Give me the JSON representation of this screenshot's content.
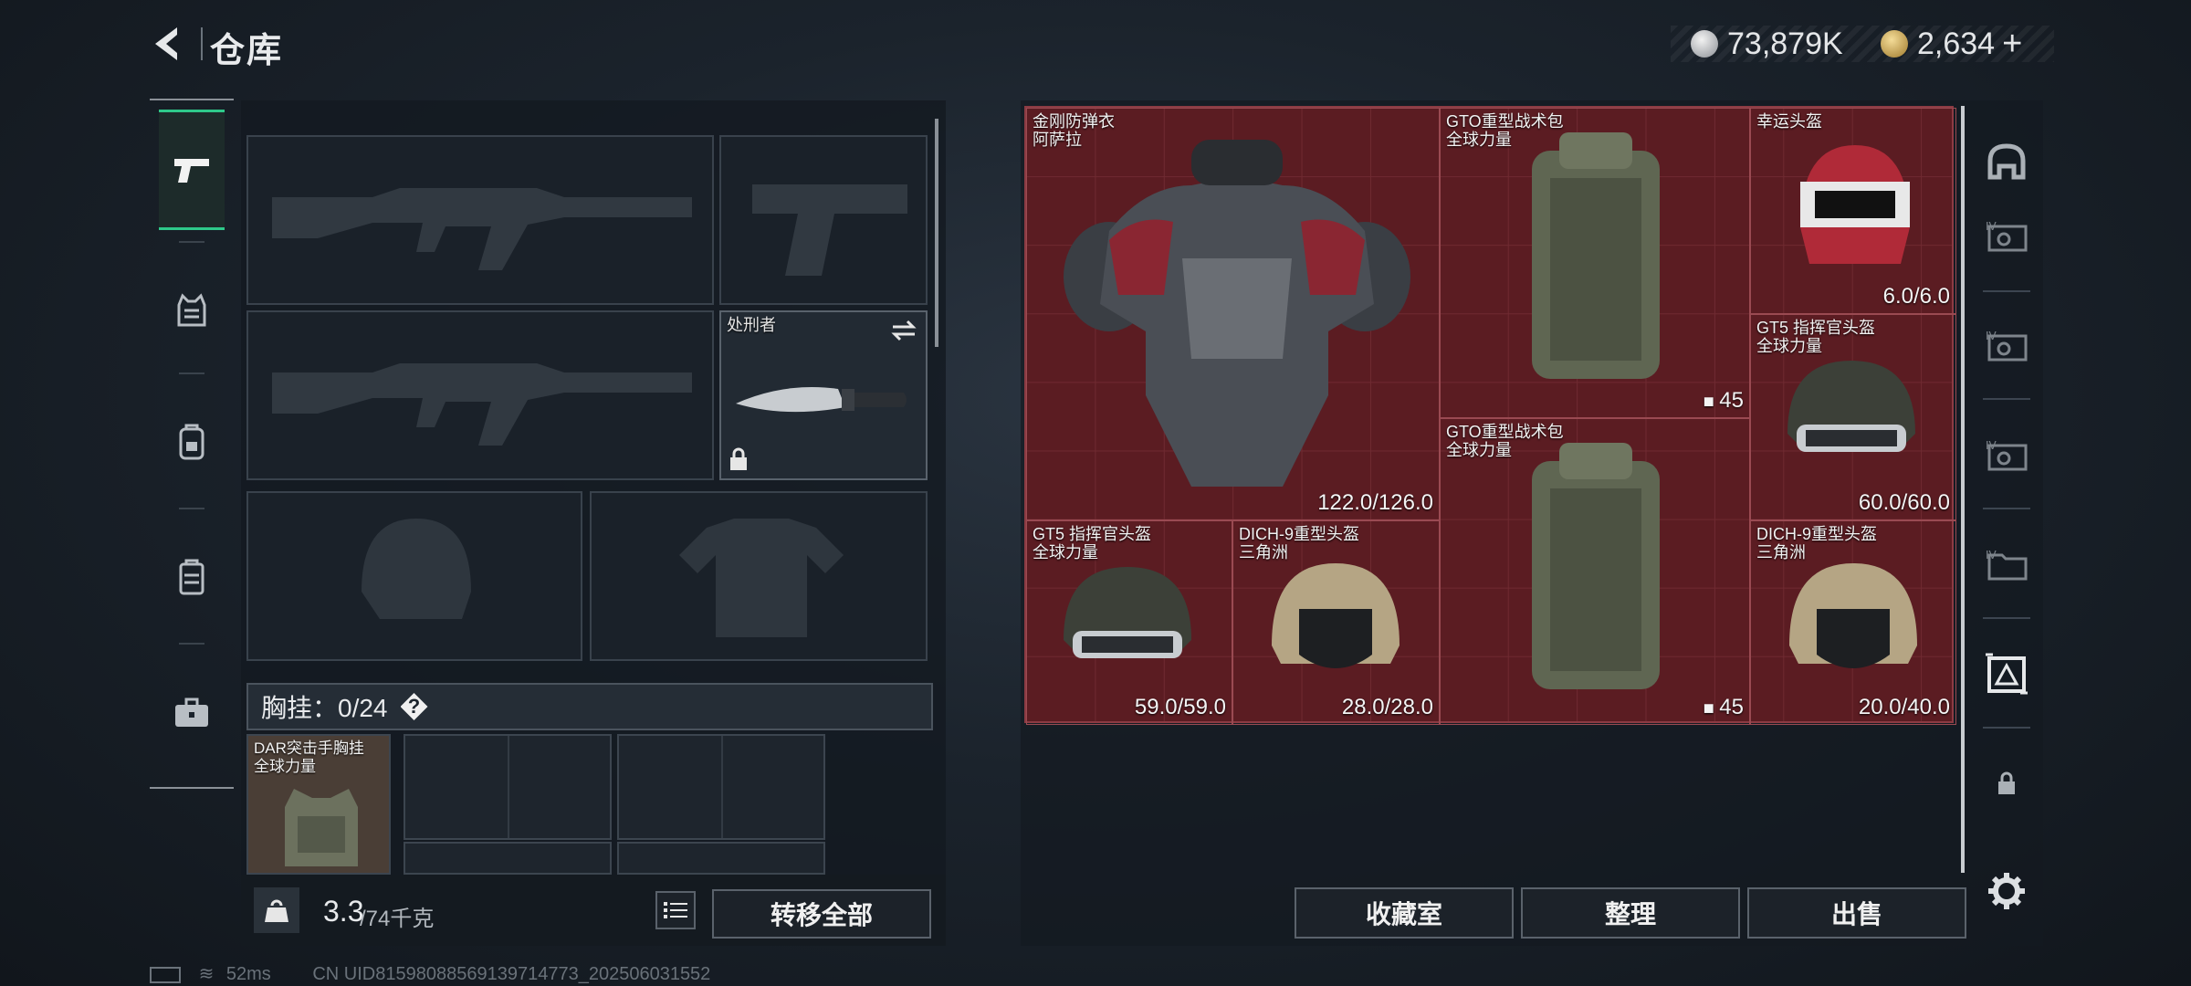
{
  "header": {
    "title": "仓库",
    "currency1": "73,879K",
    "currency2": "2,634",
    "plus": "+"
  },
  "leftpanel": {
    "melee_label": "处刑者",
    "vest_label": "胸挂：0/24",
    "help": "?",
    "vest_item_name": "DAR突击手胸挂\n全球力量",
    "weight_value": "3.3",
    "weight_max": "/74千克",
    "transfer_all": "转移全部"
  },
  "stash": {
    "items": [
      {
        "name": "金刚防弹衣\n阿萨拉",
        "durability": "122.0/126.0"
      },
      {
        "name": "GTO重型战术包\n全球力量",
        "count": "45"
      },
      {
        "name": "幸运头盔",
        "durability": "6.0/6.0"
      },
      {
        "name": "GT5 指挥官头盔\n全球力量",
        "durability": "60.0/60.0"
      },
      {
        "name": "GTO重型战术包\n全球力量",
        "count": "45"
      },
      {
        "name": "GT5 指挥官头盔\n全球力量",
        "durability": "59.0/59.0"
      },
      {
        "name": "DICH-9重型头盔\n三角洲",
        "durability": "28.0/28.0"
      },
      {
        "name": "DICH-9重型头盔\n三角洲",
        "durability": "20.0/40.0"
      }
    ]
  },
  "actions": {
    "collection": "收藏室",
    "sort": "整理",
    "sell": "出售"
  },
  "status": {
    "ping": "52ms",
    "uid": "CN UID815980885691397147​73_202506031552"
  },
  "colors": {
    "stash_bg": "#5b1c22",
    "nav_active": "#2ec98a"
  }
}
